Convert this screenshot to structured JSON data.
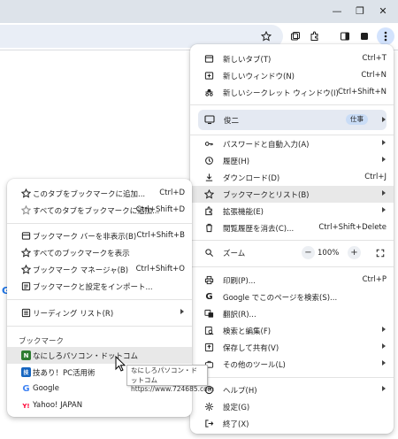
{
  "window": {
    "minimize_glyph": "—",
    "restore_glyph": "❐",
    "close_glyph": "✕"
  },
  "main_menu": {
    "items": [
      {
        "label": "新しいタブ(T)",
        "shortcut": "Ctrl+T",
        "icon": "new-tab-icon"
      },
      {
        "label": "新しいウィンドウ(N)",
        "shortcut": "Ctrl+N",
        "icon": "new-window-icon"
      },
      {
        "label": "新しいシークレット ウィンドウ(I)",
        "shortcut": "Ctrl+Shift+N",
        "icon": "incognito-icon"
      }
    ],
    "profile": {
      "name": "俊二",
      "badge": "仕事"
    },
    "items2": [
      {
        "label": "パスワードと自動入力(A)",
        "icon": "key-icon"
      },
      {
        "label": "履歴(H)",
        "icon": "history-icon"
      },
      {
        "label": "ダウンロード(D)",
        "shortcut": "Ctrl+J",
        "icon": "download-icon"
      },
      {
        "label": "ブックマークとリスト(B)",
        "icon": "star-icon"
      },
      {
        "label": "拡張機能(E)",
        "icon": "extension-icon"
      },
      {
        "label": "閲覧履歴を消去(C)...",
        "shortcut": "Ctrl+Shift+Delete",
        "icon": "trash-icon"
      }
    ],
    "zoom": {
      "label": "ズーム",
      "value": "100%",
      "minus": "−",
      "plus": "+"
    },
    "items3": [
      {
        "label": "印刷(P)...",
        "shortcut": "Ctrl+P",
        "icon": "print-icon"
      },
      {
        "label": "Google でこのページを検索(S)...",
        "icon": "google-icon"
      },
      {
        "label": "翻訳(R)...",
        "icon": "translate-icon"
      },
      {
        "label": "検索と編集(F)",
        "icon": "search-edit-icon"
      },
      {
        "label": "保存して共有(V)",
        "icon": "save-share-icon"
      },
      {
        "label": "その他のツール(L)",
        "icon": "tools-icon"
      }
    ],
    "items4": [
      {
        "label": "ヘルプ(H)",
        "icon": "help-icon"
      },
      {
        "label": "設定(G)",
        "icon": "settings-icon"
      },
      {
        "label": "終了(X)",
        "icon": "exit-icon"
      }
    ]
  },
  "bookmark_menu": {
    "items": [
      {
        "label": "このタブをブックマークに追加...",
        "shortcut": "Ctrl+D"
      },
      {
        "label": "すべてのタブをブックマークに追加...",
        "shortcut": "Ctrl+Shift+D"
      },
      {
        "label": "ブックマーク バーを非表示(B)",
        "shortcut": "Ctrl+Shift+B"
      },
      {
        "label": "すべてのブックマークを表示"
      },
      {
        "label": "ブックマーク マネージャ(B)",
        "shortcut": "Ctrl+Shift+O"
      },
      {
        "label": "ブックマークと設定をインポート..."
      },
      {
        "label": "リーディング リスト(R)"
      }
    ],
    "section_heading": "ブックマーク",
    "bookmarks": [
      {
        "label": "なにしろパソコン・ドットコム",
        "favicon": "N",
        "color": "#2e7d32"
      },
      {
        "label": "技あり！PC活用術",
        "favicon": "技",
        "color": "#1565c0"
      },
      {
        "label": "Google",
        "favicon": "G",
        "color": "#4285f4"
      },
      {
        "label": "Yahoo! JAPAN",
        "favicon": "Y!",
        "color": "#ff0033"
      }
    ]
  },
  "tooltip": {
    "title": "なにしろパソコン・ドットコム",
    "url": "https://www.724685.com"
  },
  "page_fragment": "G"
}
